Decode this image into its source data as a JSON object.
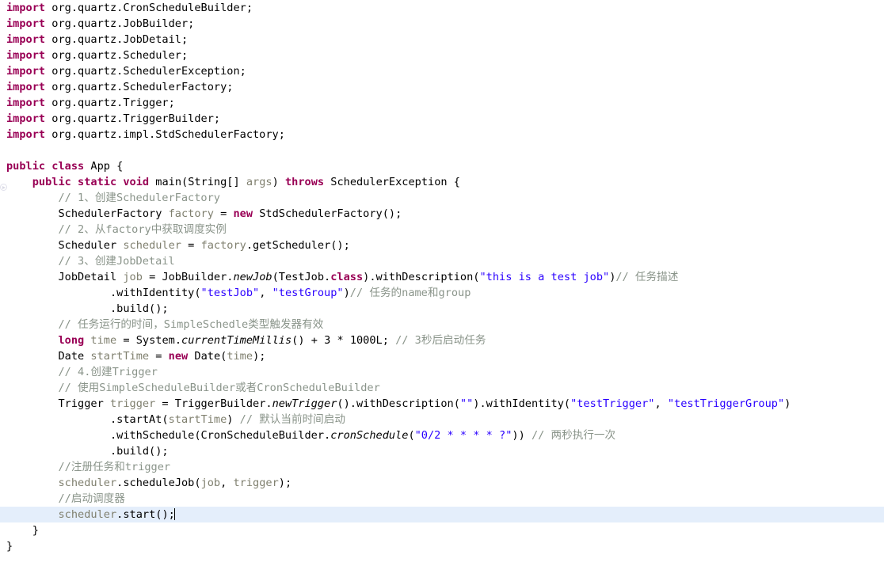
{
  "editor": {
    "file_title": "App.java",
    "language": "Java",
    "caret_line_index": 32,
    "colors": {
      "background": "#ffffff",
      "keyword": "#990055",
      "string": "#2a00ff",
      "comment": "#8a948a",
      "variable": "#7f7f6e",
      "plain": "#000000",
      "caret_line_highlight": "#e4eefb"
    },
    "gutter": {
      "run_marker_line_index": 10,
      "icon": "run-method-icon"
    }
  },
  "code": {
    "lines": [
      {
        "indent": 0,
        "tokens": [
          {
            "t": "kw",
            "s": "import"
          },
          {
            "t": "plain",
            "s": " org.quartz.CronScheduleBuilder;"
          }
        ]
      },
      {
        "indent": 0,
        "tokens": [
          {
            "t": "kw",
            "s": "import"
          },
          {
            "t": "plain",
            "s": " org.quartz.JobBuilder;"
          }
        ]
      },
      {
        "indent": 0,
        "tokens": [
          {
            "t": "kw",
            "s": "import"
          },
          {
            "t": "plain",
            "s": " org.quartz.JobDetail;"
          }
        ]
      },
      {
        "indent": 0,
        "tokens": [
          {
            "t": "kw",
            "s": "import"
          },
          {
            "t": "plain",
            "s": " org.quartz.Scheduler;"
          }
        ]
      },
      {
        "indent": 0,
        "tokens": [
          {
            "t": "kw",
            "s": "import"
          },
          {
            "t": "plain",
            "s": " org.quartz.SchedulerException;"
          }
        ]
      },
      {
        "indent": 0,
        "tokens": [
          {
            "t": "kw",
            "s": "import"
          },
          {
            "t": "plain",
            "s": " org.quartz.SchedulerFactory;"
          }
        ]
      },
      {
        "indent": 0,
        "tokens": [
          {
            "t": "kw",
            "s": "import"
          },
          {
            "t": "plain",
            "s": " org.quartz.Trigger;"
          }
        ]
      },
      {
        "indent": 0,
        "tokens": [
          {
            "t": "kw",
            "s": "import"
          },
          {
            "t": "plain",
            "s": " org.quartz.TriggerBuilder;"
          }
        ]
      },
      {
        "indent": 0,
        "tokens": [
          {
            "t": "kw",
            "s": "import"
          },
          {
            "t": "plain",
            "s": " org.quartz.impl.StdSchedulerFactory;"
          }
        ]
      },
      {
        "indent": 0,
        "tokens": []
      },
      {
        "indent": 0,
        "tokens": [
          {
            "t": "kw",
            "s": "public"
          },
          {
            "t": "plain",
            "s": " "
          },
          {
            "t": "kw",
            "s": "class"
          },
          {
            "t": "plain",
            "s": " App {"
          }
        ]
      },
      {
        "indent": 0,
        "tokens": [
          {
            "t": "plain",
            "s": "    "
          },
          {
            "t": "kw",
            "s": "public"
          },
          {
            "t": "plain",
            "s": " "
          },
          {
            "t": "kw",
            "s": "static"
          },
          {
            "t": "plain",
            "s": " "
          },
          {
            "t": "kw",
            "s": "void"
          },
          {
            "t": "plain",
            "s": " main(String[] "
          },
          {
            "t": "param",
            "s": "args"
          },
          {
            "t": "plain",
            "s": ") "
          },
          {
            "t": "kw",
            "s": "throws"
          },
          {
            "t": "plain",
            "s": " SchedulerException {"
          }
        ]
      },
      {
        "indent": 0,
        "tokens": [
          {
            "t": "plain",
            "s": "        "
          },
          {
            "t": "comment",
            "s": "// 1、创建SchedulerFactory"
          }
        ]
      },
      {
        "indent": 0,
        "tokens": [
          {
            "t": "plain",
            "s": "        SchedulerFactory "
          },
          {
            "t": "var",
            "s": "factory"
          },
          {
            "t": "plain",
            "s": " = "
          },
          {
            "t": "kw",
            "s": "new"
          },
          {
            "t": "plain",
            "s": " StdSchedulerFactory();"
          }
        ]
      },
      {
        "indent": 0,
        "tokens": [
          {
            "t": "plain",
            "s": "        "
          },
          {
            "t": "comment",
            "s": "// 2、从factory中获取调度实例"
          }
        ]
      },
      {
        "indent": 0,
        "tokens": [
          {
            "t": "plain",
            "s": "        Scheduler "
          },
          {
            "t": "var",
            "s": "scheduler"
          },
          {
            "t": "plain",
            "s": " = "
          },
          {
            "t": "var",
            "s": "factory"
          },
          {
            "t": "plain",
            "s": ".getScheduler();"
          }
        ]
      },
      {
        "indent": 0,
        "tokens": [
          {
            "t": "plain",
            "s": "        "
          },
          {
            "t": "comment",
            "s": "// 3、创建JobDetail"
          }
        ]
      },
      {
        "indent": 0,
        "tokens": [
          {
            "t": "plain",
            "s": "        JobDetail "
          },
          {
            "t": "var",
            "s": "job"
          },
          {
            "t": "plain",
            "s": " = JobBuilder."
          },
          {
            "t": "method-i",
            "s": "newJob"
          },
          {
            "t": "plain",
            "s": "(TestJob."
          },
          {
            "t": "kw",
            "s": "class"
          },
          {
            "t": "plain",
            "s": ").withDescription("
          },
          {
            "t": "string",
            "s": "\"this is a test job\""
          },
          {
            "t": "plain",
            "s": ")"
          },
          {
            "t": "comment",
            "s": "// 任务描述"
          }
        ]
      },
      {
        "indent": 0,
        "tokens": [
          {
            "t": "plain",
            "s": "                .withIdentity("
          },
          {
            "t": "string",
            "s": "\"testJob\""
          },
          {
            "t": "plain",
            "s": ", "
          },
          {
            "t": "string",
            "s": "\"testGroup\""
          },
          {
            "t": "plain",
            "s": ")"
          },
          {
            "t": "comment",
            "s": "// 任务的name和group"
          }
        ]
      },
      {
        "indent": 0,
        "tokens": [
          {
            "t": "plain",
            "s": "                .build();"
          }
        ]
      },
      {
        "indent": 0,
        "tokens": [
          {
            "t": "plain",
            "s": "        "
          },
          {
            "t": "comment",
            "s": "// 任务运行的时间，SimpleSchedle类型触发器有效"
          }
        ]
      },
      {
        "indent": 0,
        "tokens": [
          {
            "t": "plain",
            "s": "        "
          },
          {
            "t": "kw",
            "s": "long"
          },
          {
            "t": "plain",
            "s": " "
          },
          {
            "t": "var",
            "s": "time"
          },
          {
            "t": "plain",
            "s": " = System."
          },
          {
            "t": "method-i",
            "s": "currentTimeMillis"
          },
          {
            "t": "plain",
            "s": "() + 3 * 1000L; "
          },
          {
            "t": "comment",
            "s": "// 3秒后启动任务"
          }
        ]
      },
      {
        "indent": 0,
        "tokens": [
          {
            "t": "plain",
            "s": "        Date "
          },
          {
            "t": "var",
            "s": "startTime"
          },
          {
            "t": "plain",
            "s": " = "
          },
          {
            "t": "kw",
            "s": "new"
          },
          {
            "t": "plain",
            "s": " Date("
          },
          {
            "t": "var",
            "s": "time"
          },
          {
            "t": "plain",
            "s": ");"
          }
        ]
      },
      {
        "indent": 0,
        "tokens": [
          {
            "t": "plain",
            "s": "        "
          },
          {
            "t": "comment",
            "s": "// 4.创建Trigger"
          }
        ]
      },
      {
        "indent": 0,
        "tokens": [
          {
            "t": "plain",
            "s": "        "
          },
          {
            "t": "comment",
            "s": "// 使用SimpleScheduleBuilder或者CronScheduleBuilder"
          }
        ]
      },
      {
        "indent": 0,
        "tokens": [
          {
            "t": "plain",
            "s": "        Trigger "
          },
          {
            "t": "var",
            "s": "trigger"
          },
          {
            "t": "plain",
            "s": " = TriggerBuilder."
          },
          {
            "t": "method-i",
            "s": "newTrigger"
          },
          {
            "t": "plain",
            "s": "().withDescription("
          },
          {
            "t": "string",
            "s": "\"\""
          },
          {
            "t": "plain",
            "s": ").withIdentity("
          },
          {
            "t": "string",
            "s": "\"testTrigger\""
          },
          {
            "t": "plain",
            "s": ", "
          },
          {
            "t": "string",
            "s": "\"testTriggerGroup\""
          },
          {
            "t": "plain",
            "s": ")"
          }
        ]
      },
      {
        "indent": 0,
        "tokens": [
          {
            "t": "plain",
            "s": "                .startAt("
          },
          {
            "t": "var",
            "s": "startTime"
          },
          {
            "t": "plain",
            "s": ") "
          },
          {
            "t": "comment",
            "s": "// 默认当前时间启动"
          }
        ]
      },
      {
        "indent": 0,
        "tokens": [
          {
            "t": "plain",
            "s": "                .withSchedule(CronScheduleBuilder."
          },
          {
            "t": "method-i",
            "s": "cronSchedule"
          },
          {
            "t": "plain",
            "s": "("
          },
          {
            "t": "string",
            "s": "\"0/2 * * * * ?\""
          },
          {
            "t": "plain",
            "s": ")) "
          },
          {
            "t": "comment",
            "s": "// 两秒执行一次"
          }
        ]
      },
      {
        "indent": 0,
        "tokens": [
          {
            "t": "plain",
            "s": "                .build();"
          }
        ]
      },
      {
        "indent": 0,
        "tokens": [
          {
            "t": "plain",
            "s": "        "
          },
          {
            "t": "comment",
            "s": "//注册任务和trigger"
          }
        ]
      },
      {
        "indent": 0,
        "tokens": [
          {
            "t": "plain",
            "s": "        "
          },
          {
            "t": "var",
            "s": "scheduler"
          },
          {
            "t": "plain",
            "s": ".scheduleJob("
          },
          {
            "t": "var",
            "s": "job"
          },
          {
            "t": "plain",
            "s": ", "
          },
          {
            "t": "var",
            "s": "trigger"
          },
          {
            "t": "plain",
            "s": ");"
          }
        ]
      },
      {
        "indent": 0,
        "tokens": [
          {
            "t": "plain",
            "s": "        "
          },
          {
            "t": "comment",
            "s": "//启动调度器"
          }
        ]
      },
      {
        "indent": 0,
        "caret": true,
        "tokens": [
          {
            "t": "plain",
            "s": "        "
          },
          {
            "t": "var",
            "s": "scheduler"
          },
          {
            "t": "plain",
            "s": ".start();"
          }
        ]
      },
      {
        "indent": 0,
        "tokens": [
          {
            "t": "plain",
            "s": "    }"
          }
        ]
      },
      {
        "indent": 0,
        "tokens": [
          {
            "t": "plain",
            "s": "}"
          }
        ]
      }
    ]
  }
}
